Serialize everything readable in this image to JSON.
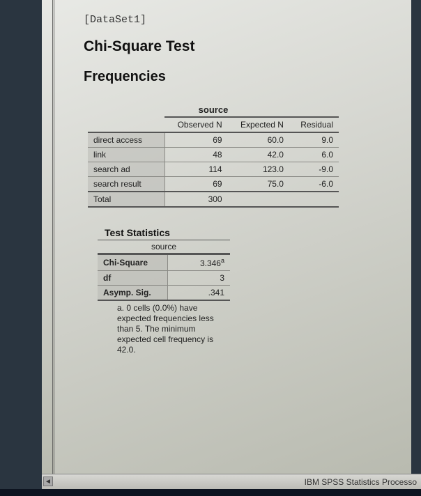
{
  "dataset_label": "[DataSet1]",
  "main_title": "Chi-Square Test",
  "section_title": "Frequencies",
  "freq": {
    "title": "source",
    "headers": {
      "c1": "Observed N",
      "c2": "Expected N",
      "c3": "Residual"
    },
    "rows": [
      {
        "label": "direct access",
        "observed": "69",
        "expected": "60.0",
        "residual": "9.0"
      },
      {
        "label": "link",
        "observed": "48",
        "expected": "42.0",
        "residual": "6.0"
      },
      {
        "label": "search ad",
        "observed": "114",
        "expected": "123.0",
        "residual": "-9.0"
      },
      {
        "label": "search result",
        "observed": "69",
        "expected": "75.0",
        "residual": "-6.0"
      }
    ],
    "total": {
      "label": "Total",
      "observed": "300",
      "expected": "",
      "residual": ""
    }
  },
  "stats": {
    "title": "Test Statistics",
    "subhead": "source",
    "rows": [
      {
        "label": "Chi-Square",
        "value": "3.346",
        "sup": "a"
      },
      {
        "label": "df",
        "value": "3",
        "sup": ""
      },
      {
        "label": "Asymp. Sig.",
        "value": ".341",
        "sup": ""
      }
    ],
    "footnote": "a. 0 cells (0.0%) have expected frequencies less than 5. The minimum expected cell frequency is 42.0."
  },
  "statusbar": "IBM SPSS Statistics Processo",
  "scroll_left": "◄"
}
